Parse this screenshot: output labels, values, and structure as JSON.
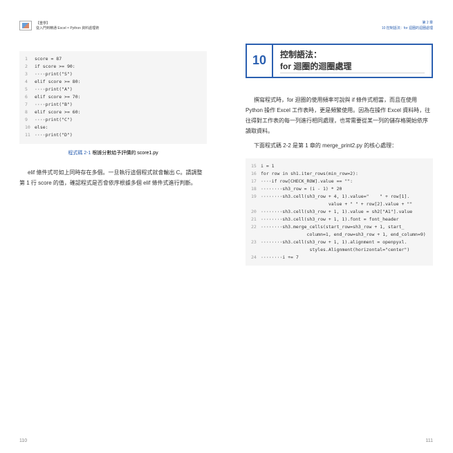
{
  "header": {
    "left_line1": "【重學】",
    "left_line2": "從入門到精通 Excel × Python 資料處理術",
    "right_line1": "第 2 章",
    "right_line2": "10 控制語法：for 迴圈的迴圈處理"
  },
  "left": {
    "code": [
      "score = 87",
      "if score >= 90:",
      "····print(\"S\")",
      "elif score >= 80:",
      "····print(\"A\")",
      "elif score >= 70:",
      "····print(\"B\")",
      "elif score >= 60:",
      "····print(\"C\")",
      "else:",
      "····print(\"D\")"
    ],
    "caption_label": "程式碼 2-1",
    "caption_text": "   根據分數給予評價的 score1.py",
    "para": "elif 條件式可如上同時存在多個。一旦執行這個程式就會輸出 C。請調整第 1 行 score 的值，確認程式是否會依序根據多個 elif 條件式進行判斷。",
    "page_num": "110"
  },
  "right": {
    "chapter_num": "10",
    "chapter_title_l1": "控制語法：",
    "chapter_title_l2": "for 迴圈的迴圈處理",
    "para1": "撰寫程式時，for 迴圈的使用頻率可說與 if 條件式相當，而且在使用 Python 操作 Excel 工作表時，更是頻繁使用。因為在操作 Excel 資料時，往往得對工作表的每一列進行相同處理，也常需要從某一列的儲存格開始依序讀取資料。",
    "para2": "下面程式碼 2-2 是第 1 章的 merge_print2.py 的核心處理：",
    "code_start": 15,
    "code": [
      "i = 1",
      "for row in sh1.iter_rows(min_row=2):",
      "····if row[CHECK_ROW].value == \"\":",
      "········sh3_row = (i - 1) * 20",
      "········sh3.cell(sh3_row + 4, 1).value=\"    \" + row[1].",
      "                         value + \" \" + row[2].value + \"\"",
      "········sh3.cell(sh3_row + 1, 1).value = sh2[\"A1\"].value",
      "········sh3.cell(sh3_row + 1, 1).font = font_header",
      "········sh3.merge_cells(start_row=sh3_row + 1, start_",
      "                 column=1, end_row=sh3_row + 1, end_column=9)",
      "········sh3.cell(sh3_row + 1, 1).alignment = openpyxl.",
      "                  styles.Alignment(horizontal=\"center\")",
      "········i += 7"
    ],
    "code_lines_shown": [
      15,
      16,
      17,
      18,
      19,
      null,
      20,
      21,
      22,
      null,
      23,
      null,
      24
    ],
    "page_num": "111"
  }
}
